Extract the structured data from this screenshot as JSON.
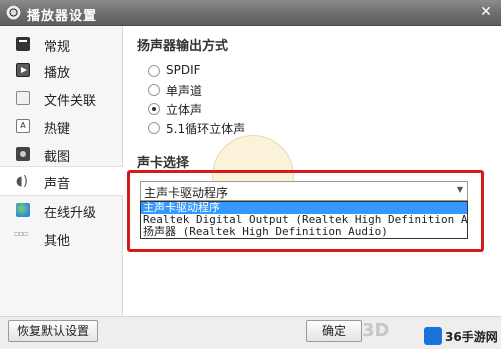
{
  "window": {
    "title": "播放器设置"
  },
  "sidebar": {
    "items": [
      {
        "label": "常规",
        "icon": "general-icon"
      },
      {
        "label": "播放",
        "icon": "play-icon"
      },
      {
        "label": "文件关联",
        "icon": "file-assoc-icon"
      },
      {
        "label": "热键",
        "icon": "hotkey-icon"
      },
      {
        "label": "截图",
        "icon": "screenshot-icon"
      },
      {
        "label": "声音",
        "icon": "speaker-icon",
        "active": true
      },
      {
        "label": "在线升级",
        "icon": "globe-icon"
      },
      {
        "label": "其他",
        "icon": "more-icon"
      }
    ]
  },
  "speaker_output": {
    "heading": "扬声器输出方式",
    "options": [
      {
        "label": "SPDIF",
        "checked": false
      },
      {
        "label": "单声道",
        "checked": false
      },
      {
        "label": "立体声",
        "checked": true
      },
      {
        "label": "5.1循环立体声",
        "checked": false
      }
    ]
  },
  "soundcard": {
    "heading": "声卡选择",
    "selected": "主声卡驱动程序",
    "options": [
      "主声卡驱动程序",
      "Realtek Digital Output (Realtek High Definition Audio)",
      "扬声器 (Realtek High Definition Audio)"
    ],
    "highlighted_index": 0
  },
  "footer": {
    "reset_label": "恢复默认设置",
    "ok_label": "确定",
    "brand": "36手游网"
  },
  "colors": {
    "highlight_border": "#d41a1a",
    "selection": "#3399ff"
  }
}
